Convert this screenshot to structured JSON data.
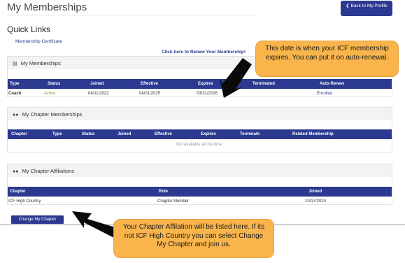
{
  "header": {
    "title": "My Memberships",
    "back_button": "Back to My Profile"
  },
  "quick_links": {
    "title": "Quick Links",
    "certificate": "Membership Certificate",
    "renew": "Click here to Renew Your Membership!"
  },
  "memberships": {
    "title": "My Memberships",
    "icon": "id-card-icon",
    "columns": [
      "Type",
      "Status",
      "Joined",
      "Effective",
      "Expires",
      "Terminated",
      "Auto-Renew"
    ],
    "rows": [
      {
        "type": "Coach",
        "status": "Active",
        "joined": "04/11/2022",
        "effective": "04/01/2025",
        "expires": "03/31/2026",
        "terminated": "",
        "auto_renew": "Enrolled"
      }
    ]
  },
  "chapter_memberships": {
    "title": "My Chapter Memberships",
    "icon": "users-icon",
    "columns": [
      "Chapter",
      "Type",
      "Status",
      "Joined",
      "Effective",
      "Expires",
      "Terminate",
      "Related Membership"
    ],
    "empty": "Not available at this time."
  },
  "chapter_affiliations": {
    "title": "My Chapter Affiliations",
    "icon": "users-icon",
    "columns": [
      "Chapter",
      "Role",
      "Joined"
    ],
    "rows": [
      {
        "chapter": "ICF High Country",
        "role": "Chapter Member",
        "joined": "10/17/2024"
      }
    ],
    "change_button": "Change My Chapter"
  },
  "callouts": {
    "expires": "This date is when your ICF membership expires. You can put it on auto-renewal.",
    "affiliation": "Your Chapter Affilation will be listed here. If its not ICF High Country you can select Change My Chapter and join us."
  },
  "colors": {
    "brand": "#2b3990",
    "callout": "#f9b54c",
    "active": "#8a9a3a"
  }
}
